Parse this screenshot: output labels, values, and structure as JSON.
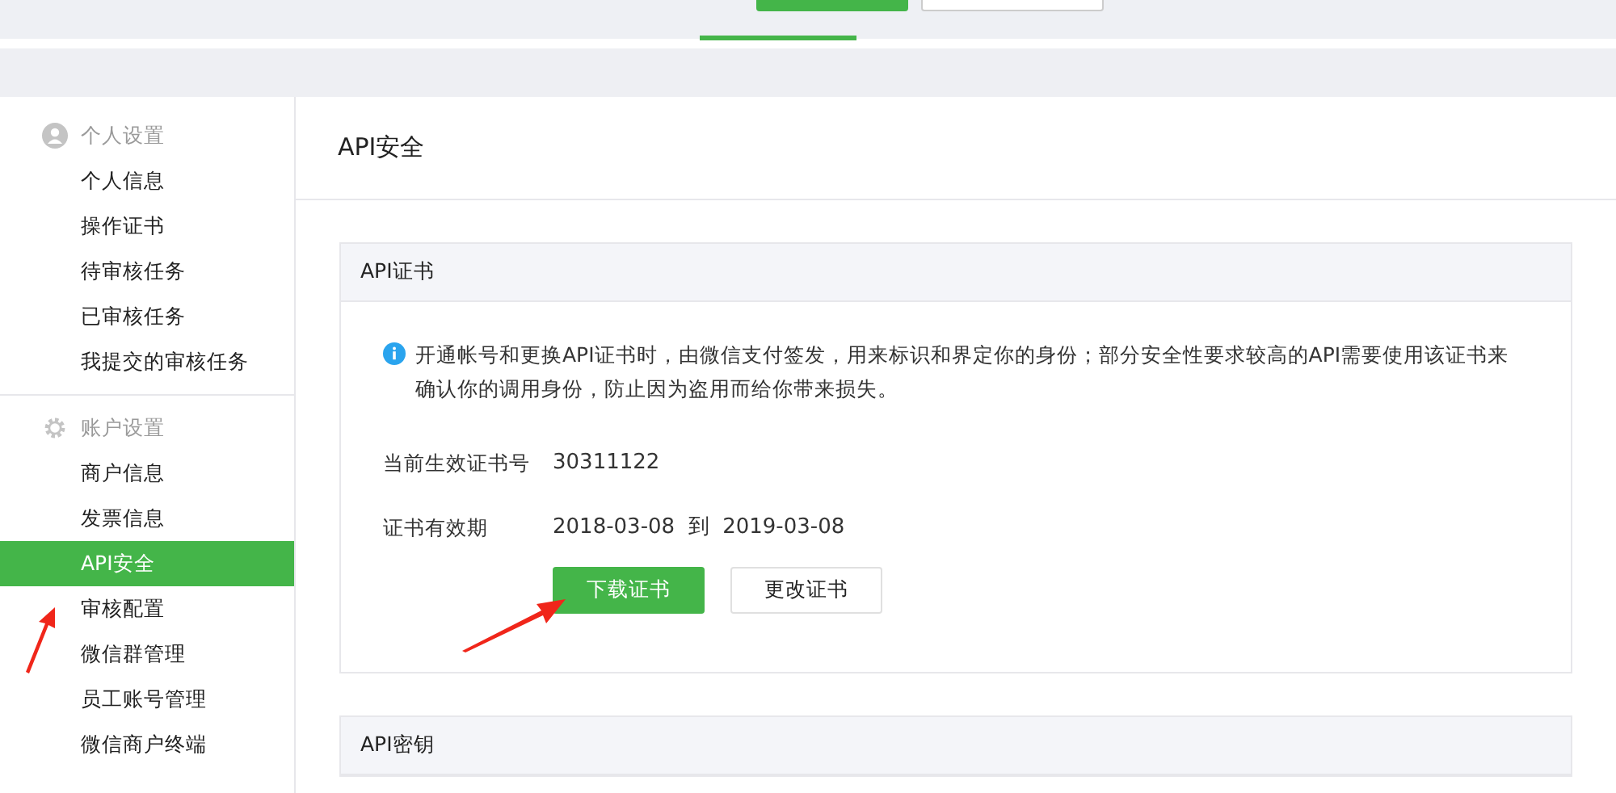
{
  "sidebar": {
    "groups": [
      {
        "title": "个人设置",
        "items": [
          {
            "label": "个人信息",
            "selected": false
          },
          {
            "label": "操作证书",
            "selected": false
          },
          {
            "label": "待审核任务",
            "selected": false
          },
          {
            "label": "已审核任务",
            "selected": false
          },
          {
            "label": "我提交的审核任务",
            "selected": false
          }
        ]
      },
      {
        "title": "账户设置",
        "items": [
          {
            "label": "商户信息",
            "selected": false
          },
          {
            "label": "发票信息",
            "selected": false
          },
          {
            "label": "API安全",
            "selected": true
          },
          {
            "label": "审核配置",
            "selected": false
          },
          {
            "label": "微信群管理",
            "selected": false
          },
          {
            "label": "员工账号管理",
            "selected": false
          },
          {
            "label": "微信商户终端",
            "selected": false
          }
        ]
      }
    ]
  },
  "page_title": "API安全",
  "cards": [
    {
      "title": "API证书",
      "notice": "开通帐号和更换API证书时，由微信支付签发，用来标识和界定你的身份；部分安全性要求较高的API需要使用该证书来确认你的调用身份，防止因为盗用而给你带来损失。",
      "fields": [
        {
          "label": "当前生效证书号",
          "value": "30311122"
        },
        {
          "label": "证书有效期",
          "value": "2018-03-08  到  2019-03-08"
        }
      ],
      "buttons": [
        {
          "label": "下载证书",
          "kind": "primary"
        },
        {
          "label": "更改证书",
          "kind": "default"
        }
      ]
    },
    {
      "title": "API密钥"
    }
  ]
}
